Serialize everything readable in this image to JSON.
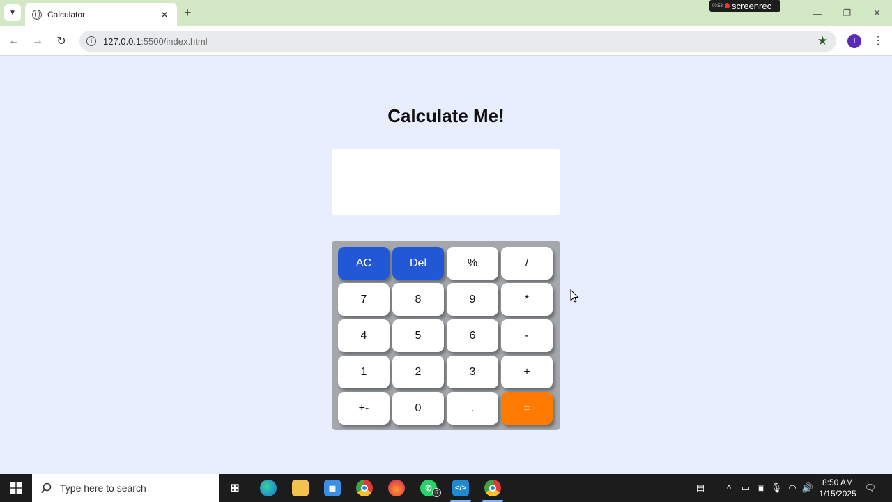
{
  "browser": {
    "tab_title": "Calculator",
    "url_host": "127.0.0.1",
    "url_path": ":5500/index.html",
    "profile_initial": "I",
    "recorder_label": "screenrec",
    "recorder_time": "00:53"
  },
  "page": {
    "title": "Calculate Me!",
    "display_value": ""
  },
  "keypad": {
    "keys": [
      {
        "label": "AC",
        "style": "blue"
      },
      {
        "label": "Del",
        "style": "blue"
      },
      {
        "label": "%",
        "style": "white"
      },
      {
        "label": "/",
        "style": "white"
      },
      {
        "label": "7",
        "style": "white"
      },
      {
        "label": "8",
        "style": "white"
      },
      {
        "label": "9",
        "style": "white"
      },
      {
        "label": "*",
        "style": "white"
      },
      {
        "label": "4",
        "style": "white"
      },
      {
        "label": "5",
        "style": "white"
      },
      {
        "label": "6",
        "style": "white"
      },
      {
        "label": "-",
        "style": "white"
      },
      {
        "label": "1",
        "style": "white"
      },
      {
        "label": "2",
        "style": "white"
      },
      {
        "label": "3",
        "style": "white"
      },
      {
        "label": "+",
        "style": "white"
      },
      {
        "label": "+-",
        "style": "white"
      },
      {
        "label": "0",
        "style": "white"
      },
      {
        "label": ".",
        "style": "white"
      },
      {
        "label": "=",
        "style": "orange"
      }
    ]
  },
  "colors": {
    "page_bg": "#e8eefd",
    "key_blue": "#2257d6",
    "key_orange": "#ff7a00",
    "keypad_bg": "#a4a7ab",
    "tabbar_bg": "#d3e8c4"
  },
  "taskbar": {
    "search_placeholder": "Type here to search",
    "whatsapp_badge": "6",
    "time": "8:50 AM",
    "date": "1/15/2025"
  }
}
